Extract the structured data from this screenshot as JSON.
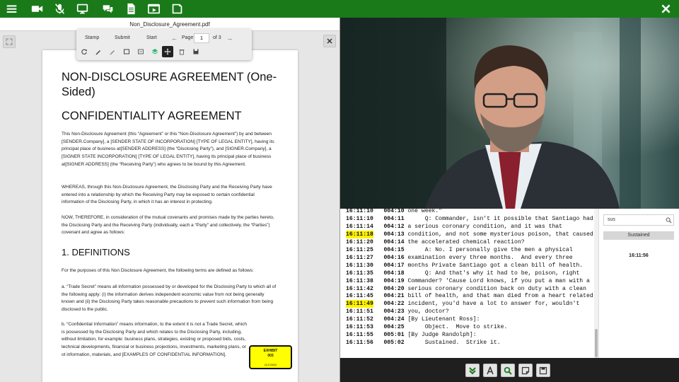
{
  "toolbar": {
    "icons": [
      "menu-icon",
      "video-camera-icon",
      "mic-off-icon",
      "monitor-icon",
      "chat-icon",
      "document-icon",
      "media-player-icon",
      "notes-icon"
    ],
    "close_icon": "close-icon",
    "accent": "#1a7a1a"
  },
  "document": {
    "filename": "Non_Disclosure_Agreement.pdf",
    "toolbar": {
      "stamp_label": "Stamp",
      "submit_label": "Submit",
      "start_label": "Start",
      "page_label": "Page",
      "page_value": "1",
      "page_total": "of 3"
    },
    "heading1": "NON-DISCLOSURE AGREEMENT (One-Sided)",
    "heading2": "CONFIDENTIALITY AGREEMENT",
    "para1": "This Non-Disclosure Agreement (this “Agreement” or this “Non-Disclosure Agreement”) by and between [SENDER.Company], a [SENDER STATE OF INCORPORATION] [TYPE OF LEGAL ENTITY], having its principal place of business at[SENDER ADDRESS] (the “Disclosing Party”), and [SIGNER.Company], a [SIGNER STATE INCORPORATION] [TYPE OF LEGAL ENTITY], having its principal place of business at[SIGNER ADDRESS] (the “Receiving Party”) who agrees to be bound by this Agreement.",
    "para2": "WHEREAS, through this Non-Disclosure Agreement, the Disclosing Party and the Receiving Party have entered into a relationship by which the Receiving Party may be exposed to certain confidential information of the Disclosing Party, in which it has an interest in protecting.",
    "para3": "NOW, THEREFORE, in consideration of the mutual covenants and promises made by the parties hereto, the Disclosing Party and the Receiving Party (individually, each a “Party” and collectively, the “Parties”) covenant and agree as follows:",
    "heading3": "1. DEFINITIONS",
    "para4": "For the purposes of this Non Disclosure Agreement, the following terms are defined as follows:",
    "para5": "a. “Trade Secret” means all information possessed by or developed for the Disclosing Party to which all of the following apply: (i) the information derives independent economic value from not being generally known and (ii) the Disclosing Party takes reasonable precautions to prevent such information from being disclosed to the public.",
    "para6": "b. “Confidential Information” means information, to the extent it is not a Trade Secret, which is possessed by the Disclosing Party and which relates to the Disclosing Party, including, without limitation, for example: business plans, strategies, existing or proposed bids, costs, technical developments, financial or business projections, investments, marketing plans, or ot information, materials, and [EXAMPLES OF CONFIDENTIAL INFORMATION].",
    "exhibit_label": "EXHIBIT",
    "exhibit_number": "003",
    "exhibit_date": "11/17/2020"
  },
  "transcript": {
    "rows": [
      {
        "time": "16:11:10",
        "line": "004:10",
        "text": "one week.\"",
        "hl": false
      },
      {
        "time": "16:11:10",
        "line": "004:11",
        "text": "     Q: Commander, isn't it possible that Santiago had",
        "hl": false
      },
      {
        "time": "16:11:14",
        "line": "004:12",
        "text": "a serious coronary condition, and it was that",
        "hl": false
      },
      {
        "time": "16:11:18",
        "line": "004:13",
        "text": "condition, and not some mysterious poison, that caused",
        "hl": true
      },
      {
        "time": "16:11:20",
        "line": "004:14",
        "text": "the accelerated chemical reaction?",
        "hl": false
      },
      {
        "time": "16:11:25",
        "line": "004:15",
        "text": "     A: No. I personally give the men a physical",
        "hl": false
      },
      {
        "time": "16:11:27",
        "line": "004:16",
        "text": "examination every three months.  And every three",
        "hl": false
      },
      {
        "time": "16:11:30",
        "line": "004:17",
        "text": "months Private Santiago got a clean bill of health.",
        "hl": false
      },
      {
        "time": "16:11:35",
        "line": "004:18",
        "text": "     Q: And that's why it had to be, poison, right",
        "hl": false
      },
      {
        "time": "16:11:38",
        "line": "004:19",
        "text": "Commander? 'Cause Lord knows, if you put a man with a",
        "hl": false
      },
      {
        "time": "16:11:42",
        "line": "004:20",
        "text": "serious coronary condition back on duty with a clean",
        "hl": false
      },
      {
        "time": "16:11:45",
        "line": "004:21",
        "text": "bill of health, and that man died from a heart related",
        "hl": false
      },
      {
        "time": "16:11:49",
        "line": "004:22",
        "text": "incident, you'd have a lot to answer for, wouldn't",
        "hl": true
      },
      {
        "time": "16:11:51",
        "line": "004:23",
        "text": "you, doctor?",
        "hl": false
      },
      {
        "time": "16:11:52",
        "line": "004:24",
        "text": "[By Lieutenant Ross]:",
        "hl": false
      },
      {
        "time": "16:11:53",
        "line": "004:25",
        "text": "     Object.  Move to strike.",
        "hl": false
      },
      {
        "time": "16:11:55",
        "line": "005:01",
        "text": "[By Judge Randolph]:",
        "hl": false
      },
      {
        "time": "16:11:56",
        "line": "005:02",
        "text": "     Sustained.  Strike it.",
        "hl": false
      }
    ]
  },
  "search": {
    "value": "sus",
    "result_tag": "Sustained",
    "result_time": "16:11:56"
  },
  "bottom_icons": [
    "double-chevron-down-icon",
    "text-icon",
    "search-icon",
    "note-icon",
    "save-icon"
  ]
}
